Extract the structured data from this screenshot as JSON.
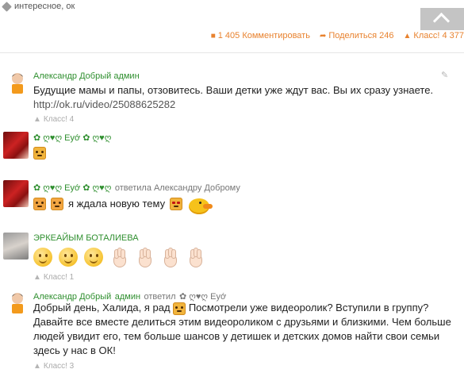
{
  "post": {
    "tags": "интересное, ок",
    "comments_label": "1 405 Комментировать",
    "share_label": "Поделиться 246",
    "likes_label": "Класс! 4 377"
  },
  "comments": [
    {
      "author": "Александр Добрый",
      "role": "админ",
      "text_line1": "Будущие мамы и папы, отзовитесь. Ваши детки уже ждут вас. Вы их сразу узнаете.",
      "link": "http://ok.ru/video/25088625282",
      "likes": "Класс! 4"
    },
    {
      "author": "✿ ღ♥ღ Еуớ ✿ ღ♥ღ"
    },
    {
      "author": "✿ ღ♥ღ Еуớ ✿ ღ♥ღ",
      "reply_verb": "ответила Александру Доброму",
      "text": "я ждала новую тему"
    },
    {
      "author": "ЭРКЕАЙЫМ БОТАЛИЕВА",
      "likes": "Класс! 1"
    },
    {
      "author": "Александр Добрый",
      "role": "админ",
      "reply_verb": "ответил",
      "reply_to": "✿ ღ♥ღ Еуớ",
      "text_a": "Добрый день, Халида, я рад",
      "text_b": "Посмотрели уже видеоролик? Вступили в группу?",
      "text_line2": "Давайте все вместе делиться этим видеороликом с друзьями и близкими. Чем больше",
      "text_line3": "людей увидит его, тем больше шансов у детишек и детских домов найти свои семьи",
      "text_line4": "здесь у нас в ОК!",
      "likes": "Класс! 3"
    }
  ],
  "icons": {
    "tag": "tag-icon",
    "comment": "comment-icon",
    "share": "share-icon",
    "like": "thumbs-up-icon",
    "edit": "pencil-icon",
    "scroll": "scroll-to-top-icon"
  },
  "colors": {
    "accent_orange": "#e8822e",
    "author_green": "#2f8f2f",
    "scroll_button": "#c4c4c4"
  }
}
